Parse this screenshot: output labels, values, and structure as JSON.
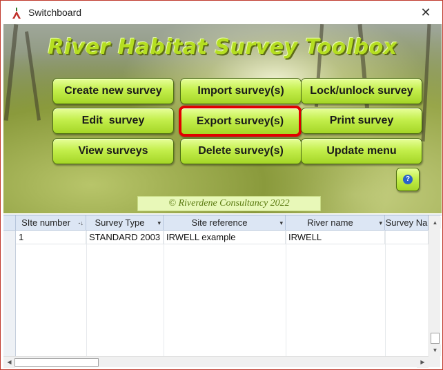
{
  "window": {
    "title": "Switchboard",
    "close_glyph": "✕",
    "app_icon": "rhs-logo-icon"
  },
  "banner": {
    "heading": "River Habitat Survey Toolbox",
    "buttons": [
      {
        "label": "Create new survey"
      },
      {
        "label": "Import survey(s)"
      },
      {
        "label": "Lock/unlock survey"
      },
      {
        "label": "Edit  survey"
      },
      {
        "label": "Export survey(s)",
        "selected": true
      },
      {
        "label": "Print survey"
      },
      {
        "label": "View surveys"
      },
      {
        "label": "Delete survey(s)"
      },
      {
        "label": "Update menu"
      }
    ],
    "help_icon": "?",
    "copyright": "© Riverdene Consultancy 2022",
    "colors": {
      "button_fill": "#c4ef4d",
      "heading": "#b5de21",
      "selected_border": "#e00000"
    }
  },
  "grid": {
    "columns": [
      {
        "label": "SIte number",
        "sort_glyph": "-↓"
      },
      {
        "label": "Survey Type",
        "sort_glyph": "▾"
      },
      {
        "label": "Site reference",
        "sort_glyph": "▾"
      },
      {
        "label": "River name",
        "sort_glyph": "▾"
      },
      {
        "label": "Survey Na",
        "sort_glyph": ""
      }
    ],
    "rows": [
      [
        "1",
        "STANDARD 2003",
        "IRWELL example",
        "IRWELL",
        ""
      ]
    ]
  }
}
